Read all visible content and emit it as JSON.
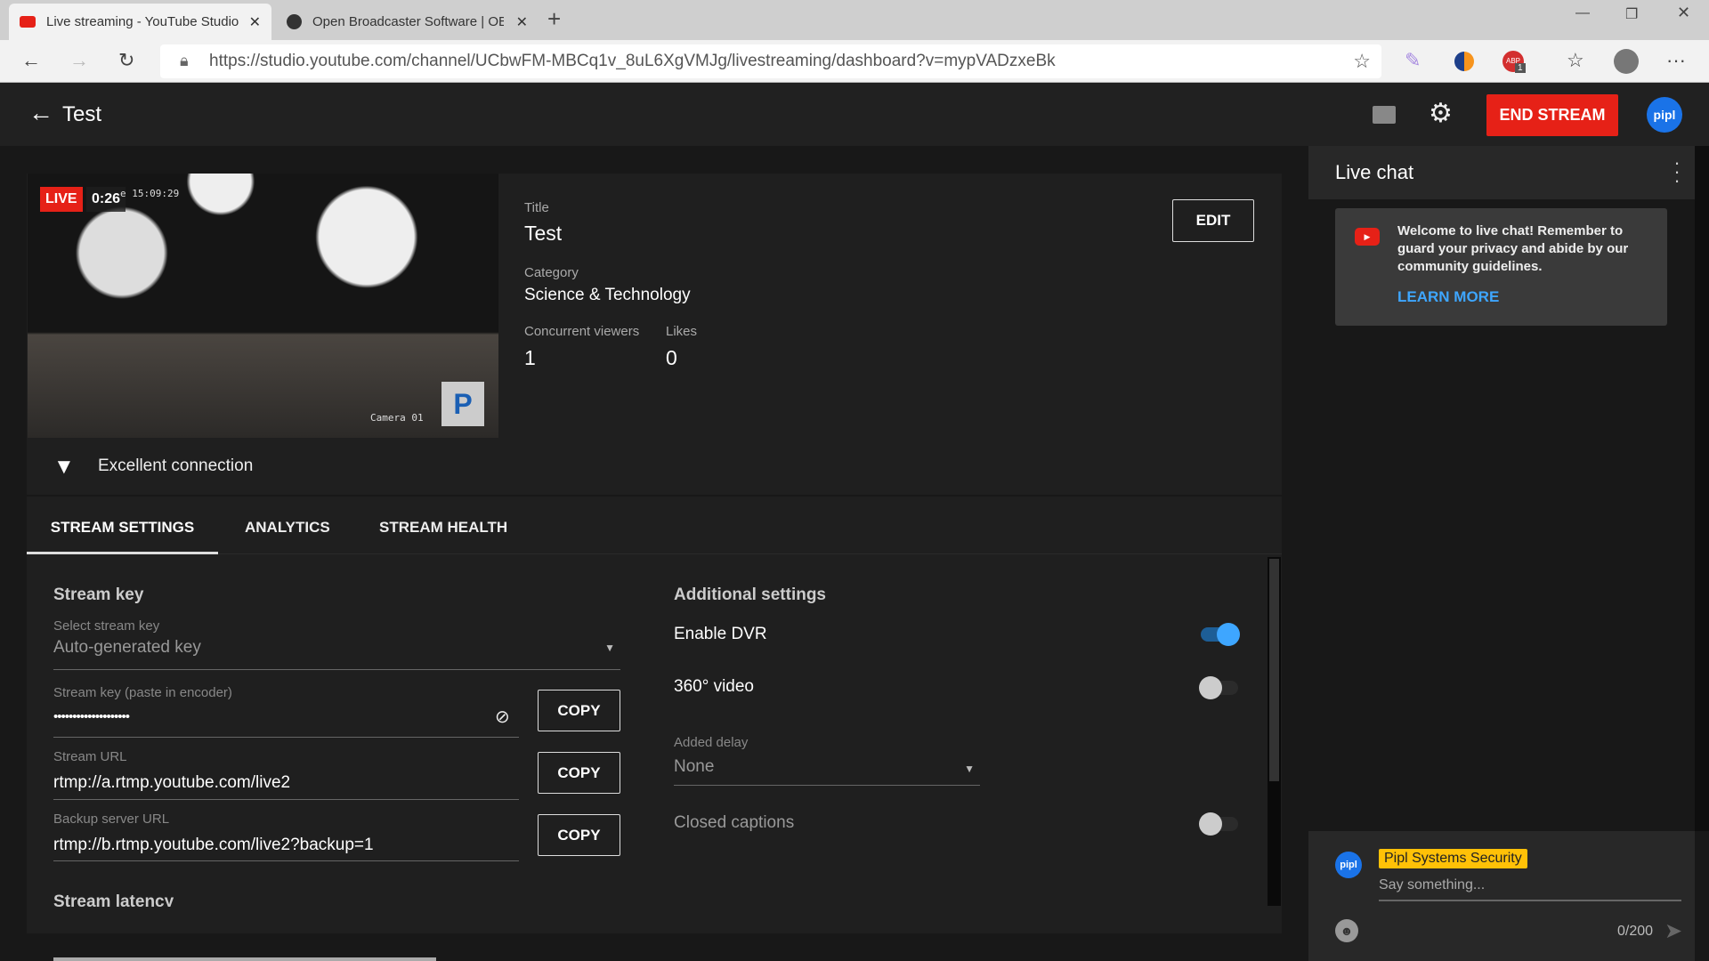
{
  "browser": {
    "tabs": [
      {
        "label": "Live streaming - YouTube Studio",
        "active": true
      },
      {
        "label": "Open Broadcaster Software | OBS",
        "active": false
      }
    ],
    "url": "https://studio.youtube.com/channel/UCbwFM-MBCq1v_8uL6XgVMJg/livestreaming/dashboard?v=mypVADzxeBk",
    "extension_badge": "1"
  },
  "header": {
    "title": "Test",
    "end_stream_label": "END STREAM",
    "avatar_text": "pipl"
  },
  "preview": {
    "live_label": "LIVE",
    "elapsed": "0:26",
    "timestamp": "e 15:09:29",
    "camera_label": "Camera 01",
    "connection": "Excellent connection"
  },
  "info": {
    "title_label": "Title",
    "title": "Test",
    "category_label": "Category",
    "category": "Science & Technology",
    "viewers_label": "Concurrent viewers",
    "viewers": "1",
    "likes_label": "Likes",
    "likes": "0",
    "edit_label": "EDIT"
  },
  "tabs": [
    {
      "label": "STREAM SETTINGS",
      "active": true
    },
    {
      "label": "ANALYTICS"
    },
    {
      "label": "STREAM HEALTH"
    }
  ],
  "stream_key": {
    "heading": "Stream key",
    "select_label": "Select stream key",
    "select_value": "Auto-generated key",
    "key_label": "Stream key (paste in encoder)",
    "key_value": "••••••••••••••••••••",
    "url_label": "Stream URL",
    "url_value": "rtmp://a.rtmp.youtube.com/live2",
    "backup_label": "Backup server URL",
    "backup_value": "rtmp://b.rtmp.youtube.com/live2?backup=1",
    "copy_label": "COPY",
    "latency_heading": "Stream latency"
  },
  "additional": {
    "heading": "Additional settings",
    "dvr_label": "Enable DVR",
    "dvr_on": true,
    "video360_label": "360° video",
    "video360_on": false,
    "delay_label": "Added delay",
    "delay_value": "None",
    "captions_label": "Closed captions",
    "captions_on": false
  },
  "chat": {
    "title": "Live chat",
    "welcome": "Welcome to live chat! Remember to guard your privacy and abide by our community guidelines.",
    "learn_more": "LEARN MORE",
    "author": "Pipl Systems Security",
    "avatar_text": "pipl",
    "placeholder": "Say something...",
    "counter": "0/200"
  },
  "colors": {
    "accent": "#3ea6ff",
    "red": "#e62117",
    "badge": "#ffc107"
  }
}
